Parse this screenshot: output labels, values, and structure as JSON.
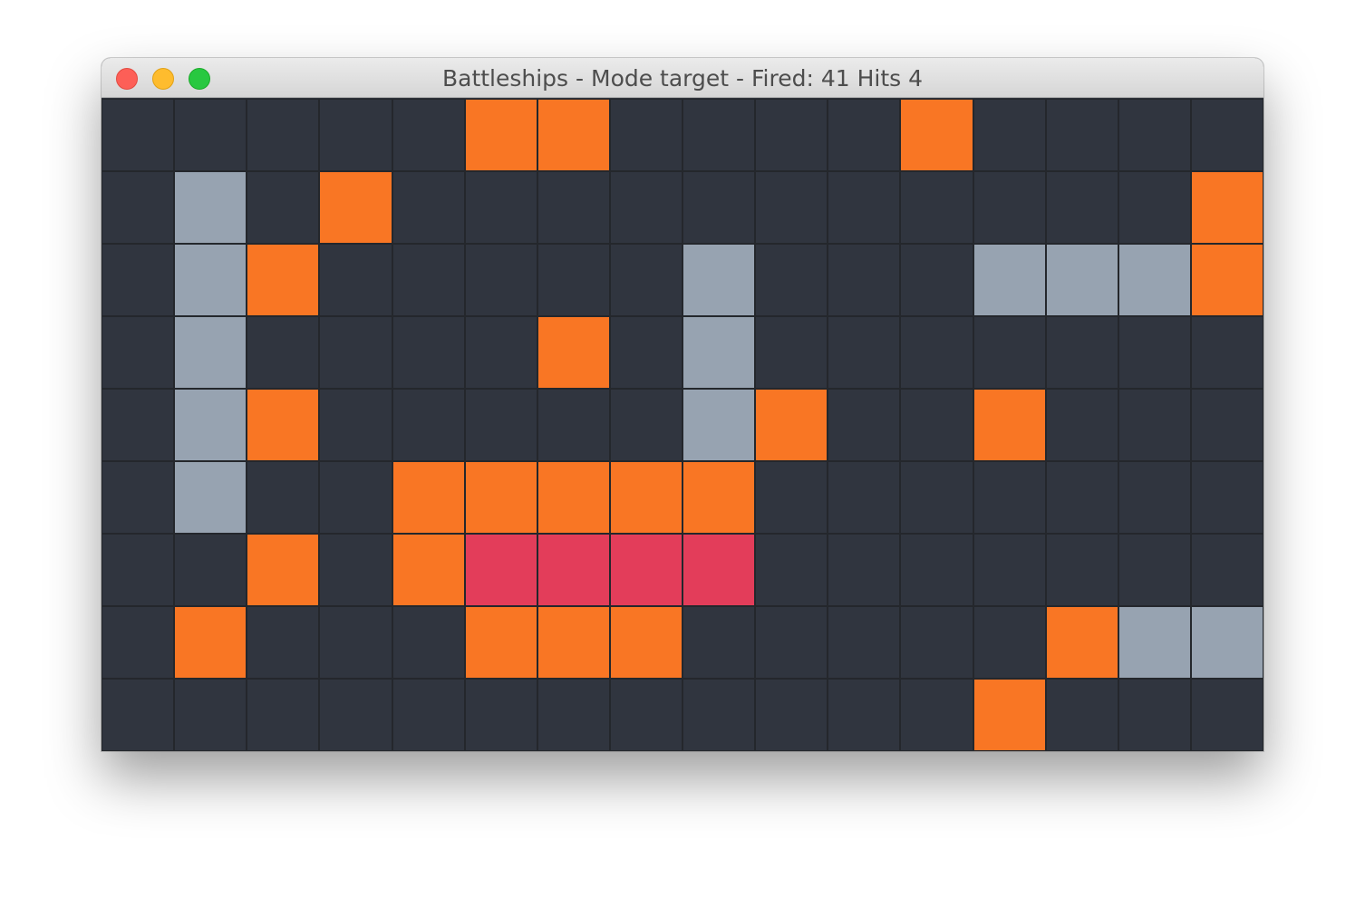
{
  "window": {
    "title": "Battleships - Mode target - Fired: 41 Hits 4"
  },
  "legend_colors": {
    "unknown": "#30353f",
    "miss": "#f97624",
    "hit": "#97a3b1",
    "sunk": "#e33d5a"
  },
  "board": {
    "columns": 16,
    "rows": [
      [
        "unknown",
        "unknown",
        "unknown",
        "unknown",
        "unknown",
        "miss",
        "miss",
        "unknown",
        "unknown",
        "unknown",
        "unknown",
        "miss",
        "unknown",
        "unknown",
        "unknown",
        "unknown"
      ],
      [
        "unknown",
        "hit",
        "unknown",
        "miss",
        "unknown",
        "unknown",
        "unknown",
        "unknown",
        "unknown",
        "unknown",
        "unknown",
        "unknown",
        "unknown",
        "unknown",
        "unknown",
        "miss"
      ],
      [
        "unknown",
        "hit",
        "miss",
        "unknown",
        "unknown",
        "unknown",
        "unknown",
        "unknown",
        "hit",
        "unknown",
        "unknown",
        "unknown",
        "hit",
        "hit",
        "hit",
        "miss"
      ],
      [
        "unknown",
        "hit",
        "unknown",
        "unknown",
        "unknown",
        "unknown",
        "miss",
        "unknown",
        "hit",
        "unknown",
        "unknown",
        "unknown",
        "unknown",
        "unknown",
        "unknown",
        "unknown"
      ],
      [
        "unknown",
        "hit",
        "miss",
        "unknown",
        "unknown",
        "unknown",
        "unknown",
        "unknown",
        "hit",
        "miss",
        "unknown",
        "unknown",
        "miss",
        "unknown",
        "unknown",
        "unknown"
      ],
      [
        "unknown",
        "hit",
        "unknown",
        "unknown",
        "miss",
        "miss",
        "miss",
        "miss",
        "miss",
        "unknown",
        "unknown",
        "unknown",
        "unknown",
        "unknown",
        "unknown",
        "unknown"
      ],
      [
        "unknown",
        "unknown",
        "miss",
        "unknown",
        "miss",
        "sunk",
        "sunk",
        "sunk",
        "sunk",
        "unknown",
        "unknown",
        "unknown",
        "unknown",
        "unknown",
        "unknown",
        "unknown"
      ],
      [
        "unknown",
        "miss",
        "unknown",
        "unknown",
        "unknown",
        "miss",
        "miss",
        "miss",
        "unknown",
        "unknown",
        "unknown",
        "unknown",
        "unknown",
        "miss",
        "hit",
        "hit"
      ],
      [
        "unknown",
        "unknown",
        "unknown",
        "unknown",
        "unknown",
        "unknown",
        "unknown",
        "unknown",
        "unknown",
        "unknown",
        "unknown",
        "unknown",
        "miss",
        "unknown",
        "unknown",
        "unknown"
      ]
    ]
  }
}
